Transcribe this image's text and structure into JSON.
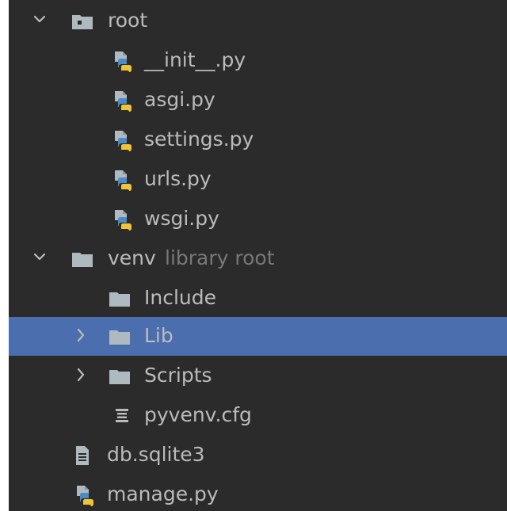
{
  "tree": {
    "root": {
      "label": "root",
      "icon": "package-folder-icon",
      "expanded": true
    },
    "root_files": [
      {
        "label": "__init__.py",
        "icon": "python-file-icon"
      },
      {
        "label": "asgi.py",
        "icon": "python-file-icon"
      },
      {
        "label": "settings.py",
        "icon": "python-file-icon"
      },
      {
        "label": "urls.py",
        "icon": "python-file-icon"
      },
      {
        "label": "wsgi.py",
        "icon": "python-file-icon"
      }
    ],
    "venv": {
      "label": "venv",
      "hint": "library root",
      "icon": "folder-icon",
      "expanded": true
    },
    "venv_children": [
      {
        "label": "Include",
        "icon": "folder-icon"
      },
      {
        "label": "Lib",
        "icon": "folder-icon",
        "selected": true,
        "expanded": false
      },
      {
        "label": "Scripts",
        "icon": "folder-icon",
        "expanded": false
      },
      {
        "label": "pyvenv.cfg",
        "icon": "config-file-icon"
      }
    ],
    "top_files": [
      {
        "label": "db.sqlite3",
        "icon": "text-file-icon"
      },
      {
        "label": "manage.py",
        "icon": "python-file-icon"
      }
    ]
  },
  "colors": {
    "background": "#2b2b2b",
    "selection": "#4b6eaf",
    "text": "#bbbbbb",
    "hint": "#787878",
    "folder": "#aeb9c0",
    "python_blue": "#4a8cc8",
    "python_yellow": "#f0c43a"
  }
}
